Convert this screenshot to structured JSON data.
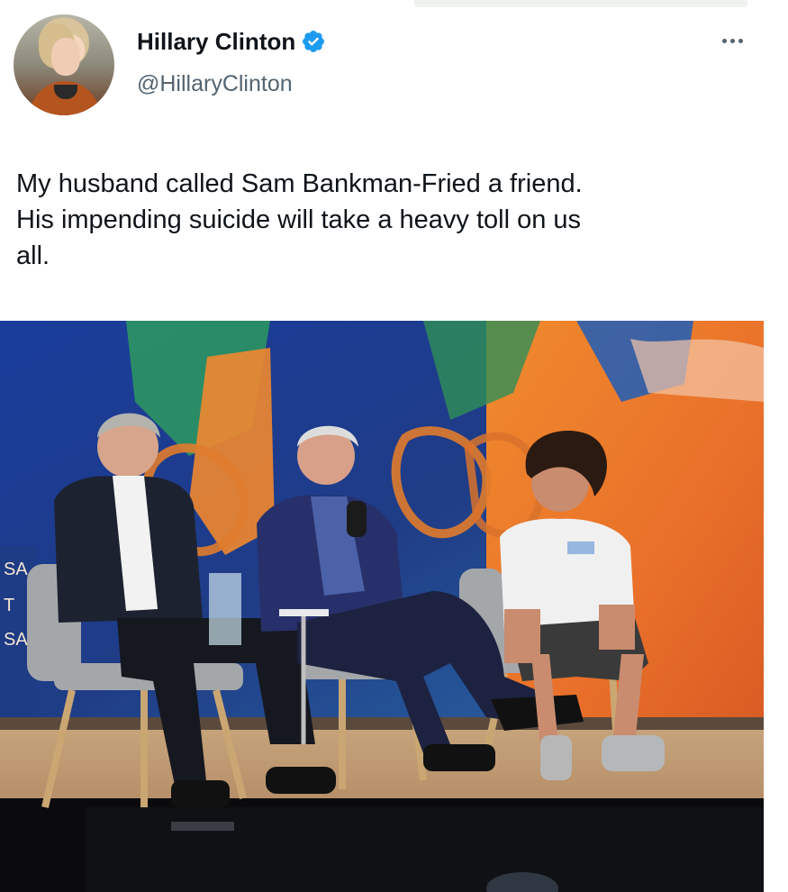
{
  "tweet": {
    "author": {
      "display_name": "Hillary Clinton",
      "handle": "@HillaryClinton",
      "verified": true,
      "avatar_icon": "profile-photo"
    },
    "text_lines": [
      "My husband called Sam Bankman-Fried a friend.",
      "His impending suicide will take a heavy toll on us",
      "all."
    ],
    "menu_icon": "more-horizontal-icon",
    "media": {
      "type": "photo",
      "stage_sign_fragments": [
        "SA",
        "T",
        "SAL"
      ]
    }
  },
  "colors": {
    "text_primary": "#0f1419",
    "text_secondary": "#536471",
    "verified_blue": "#1d9bf0",
    "background": "#ffffff"
  }
}
